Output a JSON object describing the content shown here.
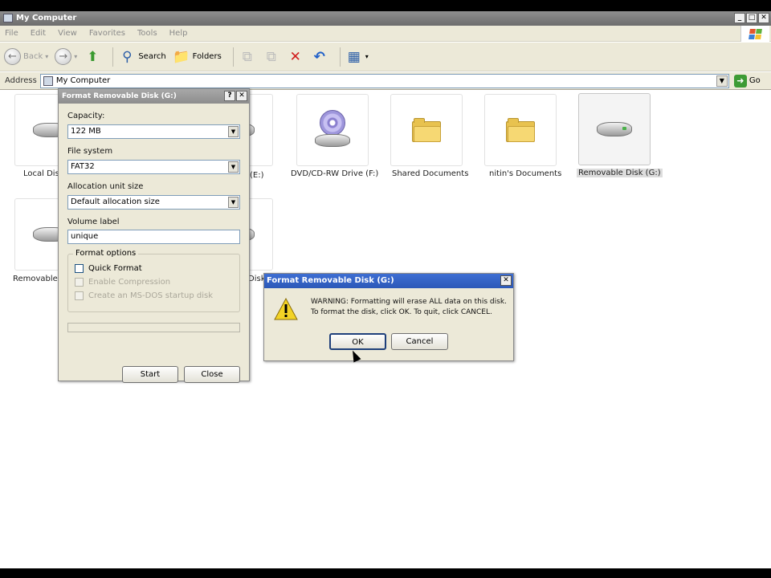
{
  "window": {
    "title": "My Computer",
    "controls": [
      "_",
      "□",
      "✕"
    ]
  },
  "menubar": {
    "items": [
      "File",
      "Edit",
      "View",
      "Favorites",
      "Tools",
      "Help"
    ]
  },
  "toolbar": {
    "back_label": "Back",
    "search_label": "Search",
    "folders_label": "Folders"
  },
  "address": {
    "label": "Address",
    "value": "My Computer",
    "go_label": "Go"
  },
  "items": [
    {
      "label": "Local Disk",
      "type": "drive"
    },
    {
      "label": "(E:)",
      "type": "drive"
    },
    {
      "label": "DVD/CD-RW Drive (F:)",
      "type": "cd"
    },
    {
      "label": "Shared Documents",
      "type": "folder"
    },
    {
      "label": "nitin's Documents",
      "type": "folder"
    },
    {
      "label": "Removable Disk (G:)",
      "type": "drive",
      "selected": true
    },
    {
      "label": "Removable I",
      "type": "drive"
    },
    {
      "label": "Disk",
      "type": "drive"
    }
  ],
  "format_dialog": {
    "title": "Format Removable Disk (G:)",
    "help_btn": "?",
    "close_btn": "✕",
    "capacity_label": "Capacity:",
    "capacity_value": "122 MB",
    "fs_label": "File system",
    "fs_value": "FAT32",
    "alloc_label": "Allocation unit size",
    "alloc_value": "Default allocation size",
    "volume_label": "Volume label",
    "volume_value": "unique",
    "options_label": "Format options",
    "quick_format": "Quick Format",
    "enable_compression": "Enable Compression",
    "msdos_startup": "Create an MS-DOS startup disk",
    "start_label": "Start",
    "close_label": "Close"
  },
  "warning_dialog": {
    "title": "Format Removable Disk (G:)",
    "close_btn": "✕",
    "line1": "WARNING: Formatting will erase ALL data on this disk.",
    "line2": "To format the disk, click OK. To quit, click CANCEL.",
    "ok_label": "OK",
    "cancel_label": "Cancel"
  }
}
